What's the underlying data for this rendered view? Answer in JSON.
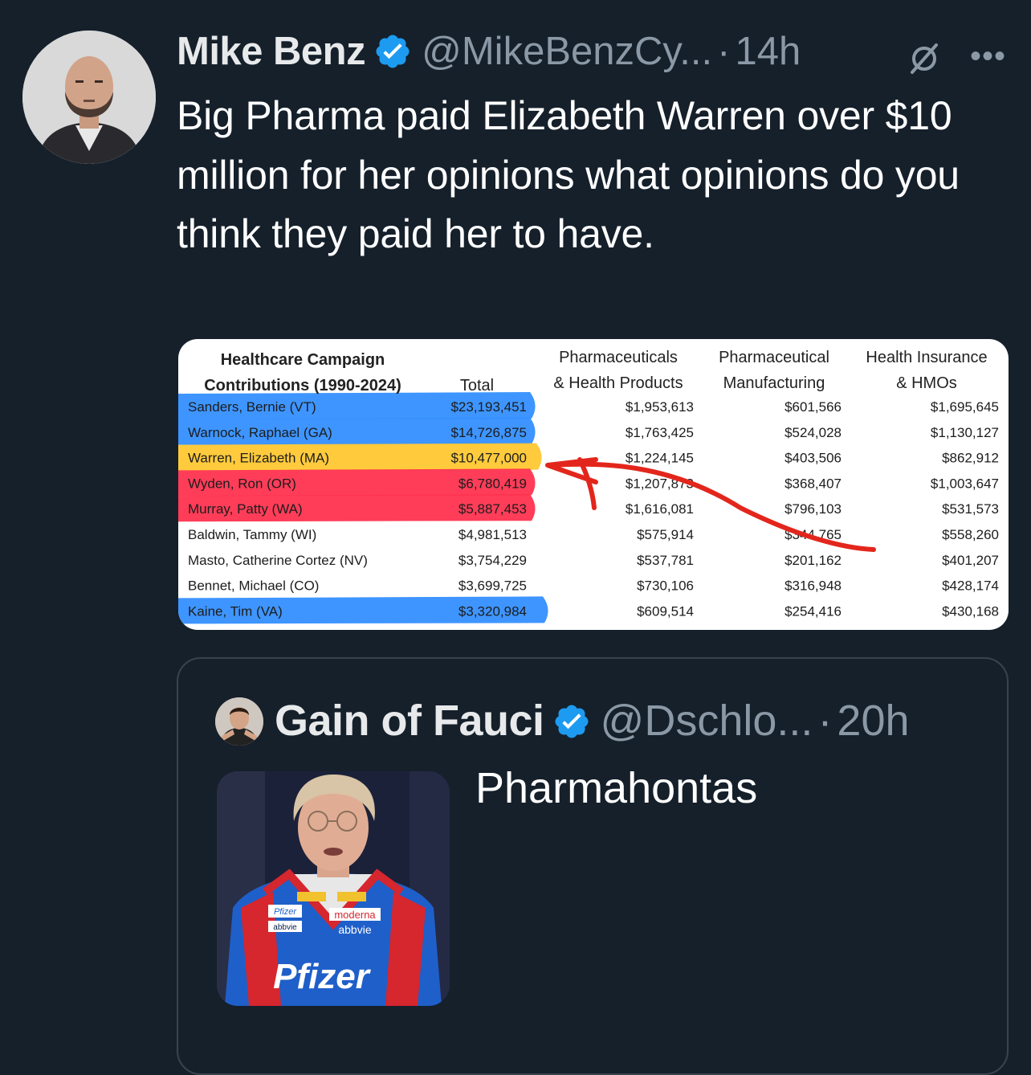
{
  "tweet": {
    "author_name": "Mike Benz",
    "author_handle": "@MikeBenzCy...",
    "separator": "·",
    "time": "14h",
    "text": "Big Pharma paid Elizabeth Warren over $10 million for her opinions what opinions do you think they paid her to have.",
    "icons": {
      "verified": "verified-badge-icon",
      "grok": "grok-icon",
      "more": "more-icon"
    }
  },
  "table": {
    "header_col0_line1": "Healthcare Campaign",
    "header_col0_line2": "Contributions (1990-2024)",
    "header_total": "Total",
    "header_col2_line1": "Pharmaceuticals",
    "header_col2_line2": "& Health Products",
    "header_col3_line1": "Pharmaceutical",
    "header_col3_line2": "Manufacturing",
    "header_col4_line1": "Health Insurance",
    "header_col4_line2": "& HMOs",
    "rows": [
      {
        "name": "Sanders, Bernie (VT)",
        "total": "$23,193,451",
        "pharma": "$1,953,613",
        "manuf": "$601,566",
        "ins": "$1,695,645",
        "highlight": "#2e8cff"
      },
      {
        "name": "Warnock, Raphael (GA)",
        "total": "$14,726,875",
        "pharma": "$1,763,425",
        "manuf": "$524,028",
        "ins": "$1,130,127",
        "highlight": "#2e8cff"
      },
      {
        "name": "Warren, Elizabeth (MA)",
        "total": "$10,477,000",
        "pharma": "$1,224,145",
        "manuf": "$403,506",
        "ins": "$862,912",
        "highlight": "#ffc72c"
      },
      {
        "name": "Wyden, Ron (OR)",
        "total": "$6,780,419",
        "pharma": "$1,207,873",
        "manuf": "$368,407",
        "ins": "$1,003,647",
        "highlight": "#ff2d4b"
      },
      {
        "name": "Murray, Patty (WA)",
        "total": "$5,887,453",
        "pharma": "$1,616,081",
        "manuf": "$796,103",
        "ins": "$531,573",
        "highlight": "#ff2d4b"
      },
      {
        "name": "Baldwin, Tammy (WI)",
        "total": "$4,981,513",
        "pharma": "$575,914",
        "manuf": "$344,765",
        "ins": "$558,260",
        "highlight": ""
      },
      {
        "name": "Masto, Catherine Cortez (NV)",
        "total": "$3,754,229",
        "pharma": "$537,781",
        "manuf": "$201,162",
        "ins": "$401,207",
        "highlight": ""
      },
      {
        "name": "Bennet, Michael (CO)",
        "total": "$3,699,725",
        "pharma": "$730,106",
        "manuf": "$316,948",
        "ins": "$428,174",
        "highlight": ""
      },
      {
        "name": "Kaine, Tim (VA)",
        "total": "$3,320,984",
        "pharma": "$609,514",
        "manuf": "$254,416",
        "ins": "$430,168",
        "highlight": "#2e8cff"
      }
    ],
    "annotation_color": "#e3261c"
  },
  "quote": {
    "author_name": "Gain of Fauci",
    "author_handle": "@Dschlo...",
    "separator": "·",
    "time": "20h",
    "text": "Pharmahontas",
    "suit_logos": [
      "Pfizer",
      "moderna",
      "abbvie",
      "abbvie",
      "Pfizer"
    ]
  }
}
